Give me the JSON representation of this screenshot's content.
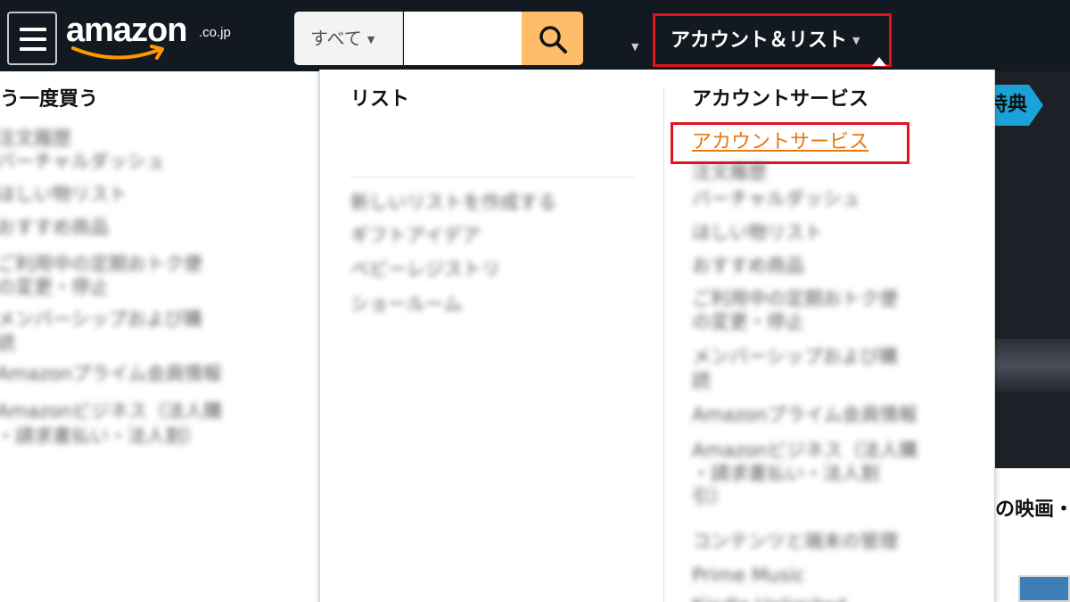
{
  "navbar": {
    "logo_text": "amazon",
    "logo_tld": ".co.jp",
    "search": {
      "category_label": "すべて",
      "input_value": "",
      "input_placeholder": ""
    },
    "account_label": "アカウント＆リスト",
    "bg_color": "#131921",
    "search_button_color": "#febd69"
  },
  "left_panel": {
    "header": "う一度買う",
    "items": [
      "注文履歴",
      "バーチャルダッシュ",
      "ほしい物リスト",
      "おすすめ商品",
      "ご利用中の定期おトク便",
      "の変更・停止",
      "メンバーシップおよび購",
      "読",
      "Amazonプライム会員情報",
      "Amazonビジネス（法人購",
      "・請求書払い・法人割）"
    ]
  },
  "flyout": {
    "list_column": {
      "title": "リスト",
      "items": [
        "新しいリストを作成する",
        "ギフトアイデア",
        "ベビーレジストリ",
        "ショールーム"
      ]
    },
    "account_column": {
      "title": "アカウントサービス",
      "highlighted_link": "アカウントサービス",
      "items": [
        "注文履歴",
        "バーチャルダッシュ",
        "ほしい物リスト",
        "おすすめ商品",
        "ご利用中の定期おトク便",
        "の変更・停止",
        "メンバーシップおよび購",
        "読",
        "Amazonプライム会員情報",
        "Amazonビジネス（法人購",
        "・請求書払い・法人割",
        "引）",
        "コンテンツと端末の管理",
        "Prime Music",
        "Kindle Unlimited"
      ]
    },
    "link_color": "#e47911",
    "highlight_color": "#e0131e"
  },
  "background": {
    "tag_text": "特典",
    "heading_text": "の映画・"
  }
}
